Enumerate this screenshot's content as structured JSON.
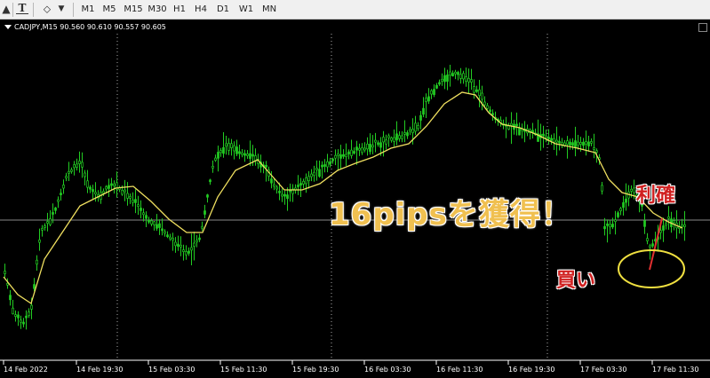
{
  "toolbar": {
    "icons": [
      "crosshair-icon",
      "text-icon",
      "label-icon",
      "shapes-icon",
      "dropdown-arrow-icon"
    ],
    "timeframes": [
      "M1",
      "M5",
      "M15",
      "M30",
      "H1",
      "H4",
      "D1",
      "W1",
      "MN"
    ]
  },
  "chart": {
    "symbol_line": "CADJPY,M15  90.560 90.610 90.557 90.605",
    "background": "#000000",
    "bull_color": "#22cc22",
    "ma_color": "#f0e060",
    "x_labels": [
      "14 Feb 2022",
      "14 Feb 19:30",
      "15 Feb 03:30",
      "15 Feb 11:30",
      "15 Feb 19:30",
      "16 Feb 03:30",
      "16 Feb 11:30",
      "16 Feb 19:30",
      "17 Feb 03:30",
      "17 Feb 11:30"
    ]
  },
  "annotations": {
    "headline": "16pipsを獲得！",
    "buy": "買い",
    "take_profit": "利確",
    "headline_color": "#f0c050",
    "marker_color": "#d02020",
    "circle_color": "#f0e040"
  }
}
